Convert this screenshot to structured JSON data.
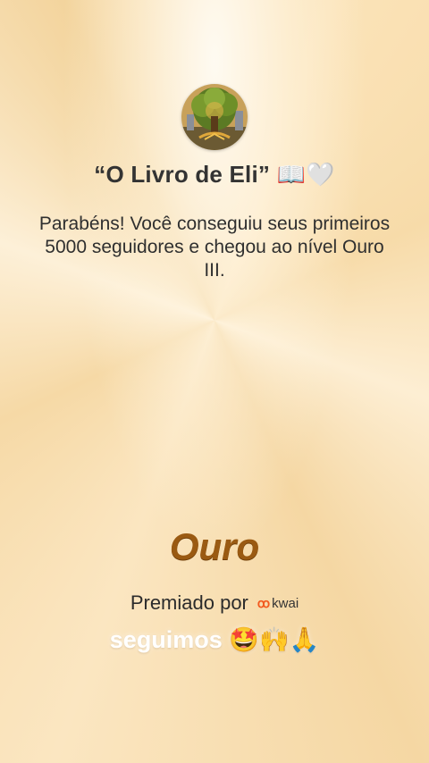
{
  "profile": {
    "avatar_icon": "tree-avatar-icon",
    "name": "“O Livro de Eli”",
    "name_emojis": "📖🤍"
  },
  "message": "Parabéns! Você conseguiu seus primeiros 5000 seguidores e chegou ao nível Ouro III.",
  "level": "Ouro",
  "awarded": {
    "label": "Premiado por",
    "brand_mark": "ꝏ",
    "brand_name": "kwai",
    "brand_icon": "kwai-logo-icon"
  },
  "caption": {
    "text": "seguimos",
    "emojis": "🤩🙌🙏"
  },
  "colors": {
    "level_gold": "#9a5a12",
    "kwai_orange": "#f25a1f"
  }
}
